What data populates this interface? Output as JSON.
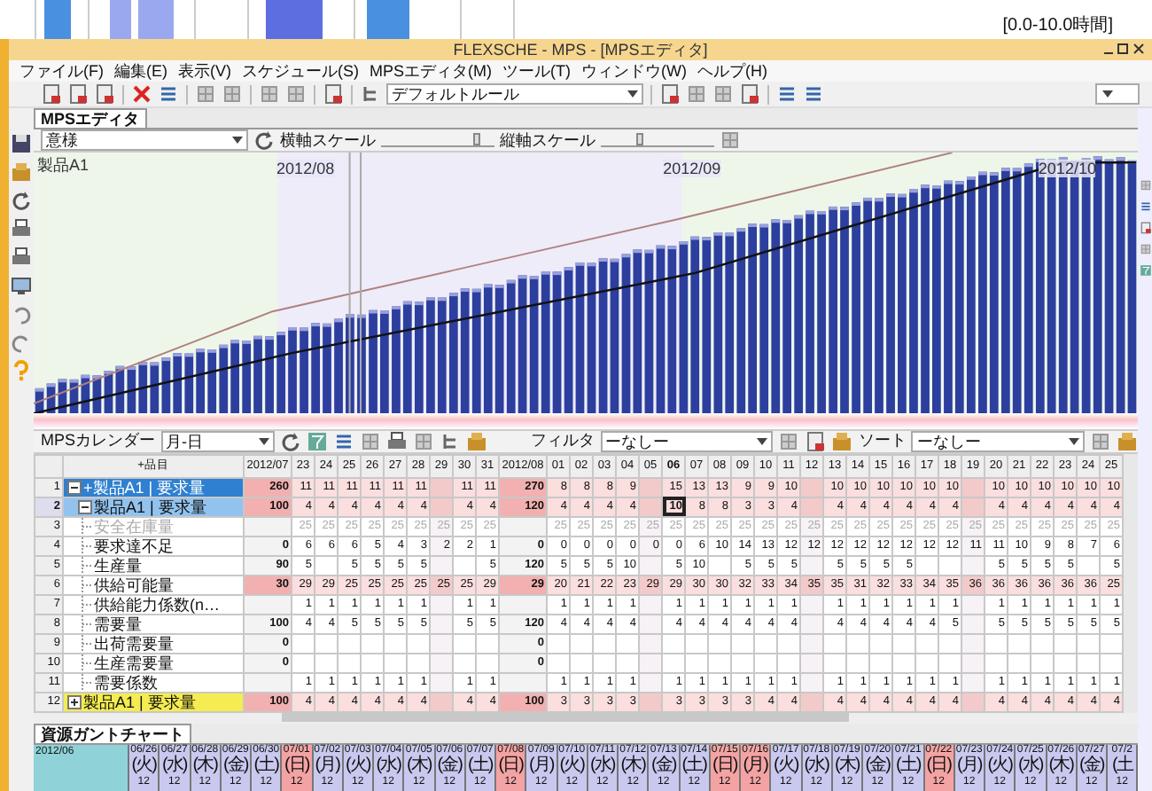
{
  "background_window": {
    "range": "[0.0-10.0時間]"
  },
  "window": {
    "title": "FLEXSCHE - MPS - [MPSエディタ]"
  },
  "menu": [
    "ファイル(F)",
    "編集(E)",
    "表示(V)",
    "スケジュール(S)",
    "MPSエディタ(M)",
    "ツール(T)",
    "ウィンドウ(W)",
    "ヘルプ(H)"
  ],
  "toolbar": {
    "rule": "デフォルトルール"
  },
  "tabs": [
    {
      "label": "MPSエディタ",
      "selected": true
    }
  ],
  "chart_toolbar": {
    "mode": "意様",
    "x_scale_label": "横軸スケール",
    "x_scale": {
      "level": 0.85
    },
    "y_scale_label": "縦軸スケール",
    "y_scale": {
      "level": 0.35
    }
  },
  "chart": {
    "title": "製品A1",
    "months": [
      "2012/08",
      "2012/09",
      "2012/10"
    ]
  },
  "grid_toolbar": {
    "calendar_label": "MPSカレンダー",
    "calendar": "月-日",
    "filter_label": "フィルタ",
    "filter": "ーなしー",
    "sort_label": "ソート",
    "sort": "ーなしー"
  },
  "grid": {
    "corner": "+品目",
    "columns": [
      {
        "label": "2012/07",
        "kind": "month",
        "selected": false
      },
      {
        "label": "23",
        "kind": "day",
        "selected": false
      },
      {
        "label": "24",
        "kind": "day",
        "selected": false
      },
      {
        "label": "25",
        "kind": "day",
        "selected": false
      },
      {
        "label": "26",
        "kind": "day",
        "selected": false
      },
      {
        "label": "27",
        "kind": "day",
        "selected": false
      },
      {
        "label": "28",
        "kind": "day",
        "selected": false
      },
      {
        "label": "29",
        "kind": "holiday",
        "selected": false
      },
      {
        "label": "30",
        "kind": "day",
        "selected": false
      },
      {
        "label": "31",
        "kind": "day",
        "selected": false
      },
      {
        "label": "2012/08",
        "kind": "month",
        "selected": false
      },
      {
        "label": "01",
        "kind": "day",
        "selected": false
      },
      {
        "label": "02",
        "kind": "day",
        "selected": false
      },
      {
        "label": "03",
        "kind": "day",
        "selected": false
      },
      {
        "label": "04",
        "kind": "day",
        "selected": false
      },
      {
        "label": "05",
        "kind": "holiday",
        "selected": false
      },
      {
        "label": "06",
        "kind": "day",
        "selected": true
      },
      {
        "label": "07",
        "kind": "day",
        "selected": false
      },
      {
        "label": "08",
        "kind": "day",
        "selected": false
      },
      {
        "label": "09",
        "kind": "day",
        "selected": false
      },
      {
        "label": "10",
        "kind": "day",
        "selected": false
      },
      {
        "label": "11",
        "kind": "day",
        "selected": false
      },
      {
        "label": "12",
        "kind": "holiday",
        "selected": false
      },
      {
        "label": "13",
        "kind": "day",
        "selected": false
      },
      {
        "label": "14",
        "kind": "day",
        "selected": false
      },
      {
        "label": "15",
        "kind": "day",
        "selected": false
      },
      {
        "label": "16",
        "kind": "day",
        "selected": false
      },
      {
        "label": "17",
        "kind": "day",
        "selected": false
      },
      {
        "label": "18",
        "kind": "day",
        "selected": false
      },
      {
        "label": "19",
        "kind": "holiday",
        "selected": false
      },
      {
        "label": "20",
        "kind": "day",
        "selected": false
      },
      {
        "label": "21",
        "kind": "day",
        "selected": false
      },
      {
        "label": "22",
        "kind": "day",
        "selected": false
      },
      {
        "label": "23",
        "kind": "day",
        "selected": false
      },
      {
        "label": "24",
        "kind": "day",
        "selected": false
      },
      {
        "label": "25",
        "kind": "day",
        "selected": false
      }
    ],
    "rows": [
      {
        "number": "1",
        "label": "+製品A1 | 要求量",
        "kind": "group",
        "expanded": true,
        "selected": false,
        "highlight": true,
        "disabled": false,
        "cells": [
          "260",
          "11",
          "11",
          "11",
          "11",
          "11",
          "11",
          null,
          "11",
          "11",
          "270",
          "8",
          "8",
          "8",
          "9",
          null,
          "15",
          "13",
          "13",
          "9",
          "9",
          "10",
          null,
          "10",
          "10",
          "10",
          "10",
          "10",
          "10",
          null,
          "10",
          "10",
          "10",
          "10",
          "10",
          "10"
        ]
      },
      {
        "number": "2",
        "label": "製品A1 | 要求量",
        "kind": "item",
        "expanded": true,
        "selected": true,
        "highlight": true,
        "disabled": false,
        "cells": [
          "100",
          "4",
          "4",
          "4",
          "4",
          "4",
          "4",
          null,
          "4",
          "4",
          "120",
          "4",
          "4",
          "4",
          "4",
          null,
          "10",
          "8",
          "8",
          "3",
          "3",
          "4",
          null,
          "4",
          "4",
          "4",
          "4",
          "4",
          "4",
          null,
          "4",
          "4",
          "4",
          "4",
          "4",
          "4"
        ]
      },
      {
        "number": "3",
        "label": "安全在庫量",
        "kind": "attribute",
        "selected": false,
        "highlight": false,
        "disabled": true,
        "cells": [
          null,
          "25",
          "25",
          "25",
          "25",
          "25",
          "25",
          "25",
          "25",
          "25",
          null,
          "25",
          "25",
          "25",
          "25",
          "25",
          "25",
          "25",
          "25",
          "25",
          "25",
          "25",
          "25",
          "25",
          "25",
          "25",
          "25",
          "25",
          "25",
          "25",
          "25",
          "25",
          "25",
          "25",
          "25",
          "25"
        ]
      },
      {
        "number": "4",
        "label": "要求達不足",
        "kind": "attribute",
        "selected": false,
        "highlight": false,
        "disabled": false,
        "cells": [
          "0",
          "6",
          "6",
          "6",
          "5",
          "4",
          "3",
          "2",
          "2",
          "1",
          "0",
          "0",
          "0",
          "0",
          "0",
          "0",
          "0",
          "6",
          "10",
          "14",
          "13",
          "12",
          "12",
          "12",
          "12",
          "12",
          "12",
          "12",
          "12",
          "11",
          "11",
          "10",
          "9",
          "8",
          "7",
          "6"
        ]
      },
      {
        "number": "5",
        "label": "生産量",
        "kind": "attribute",
        "selected": false,
        "highlight": false,
        "disabled": false,
        "cells": [
          "90",
          "5",
          null,
          "5",
          "5",
          "5",
          "5",
          null,
          null,
          "5",
          "120",
          "5",
          "5",
          "5",
          "10",
          null,
          "5",
          "10",
          null,
          "5",
          "5",
          "5",
          null,
          "5",
          "5",
          "5",
          "5",
          null,
          null,
          null,
          "5",
          "5",
          "5",
          "5",
          null,
          "5"
        ]
      },
      {
        "number": "6",
        "label": "供給可能量",
        "kind": "attribute",
        "selected": false,
        "highlight": true,
        "disabled": false,
        "cells": [
          "30",
          "29",
          "29",
          "25",
          "25",
          "25",
          "25",
          "25",
          "25",
          "29",
          "29",
          "20",
          "21",
          "22",
          "23",
          "29",
          "29",
          "30",
          "30",
          "32",
          "33",
          "34",
          "35",
          "35",
          "31",
          "32",
          "33",
          "34",
          "35",
          "36",
          "36",
          "36",
          "36",
          "36",
          "36",
          "25"
        ]
      },
      {
        "number": "7",
        "label": "供給能力係数(n…",
        "kind": "attribute",
        "selected": false,
        "highlight": false,
        "disabled": false,
        "cells": [
          null,
          "1",
          "1",
          "1",
          "1",
          "1",
          "1",
          null,
          "1",
          "1",
          null,
          "1",
          "1",
          "1",
          "1",
          null,
          "1",
          "1",
          "1",
          "1",
          "1",
          "1",
          null,
          "1",
          "1",
          "1",
          "1",
          "1",
          "1",
          null,
          "1",
          "1",
          "1",
          "1",
          "1",
          "1"
        ]
      },
      {
        "number": "8",
        "label": "需要量",
        "kind": "attribute",
        "selected": false,
        "highlight": false,
        "disabled": false,
        "cells": [
          "100",
          "4",
          "4",
          "5",
          "5",
          "5",
          "5",
          null,
          "5",
          "5",
          "120",
          "4",
          "4",
          "4",
          "4",
          null,
          "4",
          "4",
          "4",
          "4",
          "4",
          "4",
          null,
          "4",
          "4",
          "4",
          "4",
          "4",
          "5",
          null,
          "5",
          "5",
          "5",
          "5",
          "5",
          "5"
        ]
      },
      {
        "number": "9",
        "label": "出荷需要量",
        "kind": "attribute",
        "selected": false,
        "highlight": false,
        "disabled": false,
        "cells": [
          "0",
          null,
          null,
          null,
          null,
          null,
          null,
          null,
          null,
          null,
          "0",
          null,
          null,
          null,
          null,
          null,
          null,
          null,
          null,
          null,
          null,
          null,
          null,
          null,
          null,
          null,
          null,
          null,
          null,
          null,
          null,
          null,
          null,
          null,
          null,
          null
        ]
      },
      {
        "number": "10",
        "label": "生産需要量",
        "kind": "attribute",
        "selected": false,
        "highlight": false,
        "disabled": false,
        "cells": [
          "0",
          null,
          null,
          null,
          null,
          null,
          null,
          null,
          null,
          null,
          "0",
          null,
          null,
          null,
          null,
          null,
          null,
          null,
          null,
          null,
          null,
          null,
          null,
          null,
          null,
          null,
          null,
          null,
          null,
          null,
          null,
          null,
          null,
          null,
          null,
          null
        ]
      },
      {
        "number": "11",
        "label": "需要係数",
        "kind": "attribute",
        "selected": false,
        "highlight": false,
        "disabled": false,
        "cells": [
          null,
          "1",
          "1",
          "1",
          "1",
          "1",
          "1",
          null,
          "1",
          "1",
          null,
          "1",
          "1",
          "1",
          "1",
          null,
          "1",
          "1",
          "1",
          "1",
          "1",
          "1",
          null,
          "1",
          "1",
          "1",
          "1",
          "1",
          "1",
          null,
          "1",
          "1",
          "1",
          "1",
          "1",
          "1"
        ]
      },
      {
        "number": "12",
        "label": "製品A1 | 要求量",
        "kind": "total",
        "expanded": false,
        "selected": false,
        "highlight": true,
        "disabled": false,
        "cells": [
          "100",
          "4",
          "4",
          "4",
          "4",
          "4",
          "4",
          null,
          "4",
          "4",
          "100",
          "3",
          "3",
          "3",
          "3",
          null,
          "3",
          "3",
          "3",
          "3",
          "4",
          "4",
          null,
          "4",
          "4",
          "4",
          "4",
          "4",
          "4",
          null,
          "4",
          "4",
          "4",
          "4",
          "4",
          "4"
        ]
      }
    ]
  },
  "gantt": {
    "tab": "資源ガントチャート",
    "month": "2012/06",
    "days": [
      {
        "date": "06/26",
        "weekday": "(火)",
        "value": "12",
        "holiday": false
      },
      {
        "date": "06/27",
        "weekday": "(水)",
        "value": "12",
        "holiday": false
      },
      {
        "date": "06/28",
        "weekday": "(木)",
        "value": "12",
        "holiday": false
      },
      {
        "date": "06/29",
        "weekday": "(金)",
        "value": "12",
        "holiday": false
      },
      {
        "date": "06/30",
        "weekday": "(土)",
        "value": "12",
        "holiday": false
      },
      {
        "date": "07/01",
        "weekday": "(日)",
        "value": "12",
        "holiday": true
      },
      {
        "date": "07/02",
        "weekday": "(月)",
        "value": "12",
        "holiday": false
      },
      {
        "date": "07/03",
        "weekday": "(火)",
        "value": "12",
        "holiday": false
      },
      {
        "date": "07/04",
        "weekday": "(水)",
        "value": "12",
        "holiday": false
      },
      {
        "date": "07/05",
        "weekday": "(木)",
        "value": "12",
        "holiday": false
      },
      {
        "date": "07/06",
        "weekday": "(金)",
        "value": "12",
        "holiday": false
      },
      {
        "date": "07/07",
        "weekday": "(土)",
        "value": "12",
        "holiday": false
      },
      {
        "date": "07/08",
        "weekday": "(日)",
        "value": "12",
        "holiday": true
      },
      {
        "date": "07/09",
        "weekday": "(月)",
        "value": "12",
        "holiday": false
      },
      {
        "date": "07/10",
        "weekday": "(火)",
        "value": "12",
        "holiday": false
      },
      {
        "date": "07/11",
        "weekday": "(水)",
        "value": "12",
        "holiday": false
      },
      {
        "date": "07/12",
        "weekday": "(木)",
        "value": "12",
        "holiday": false
      },
      {
        "date": "07/13",
        "weekday": "(金)",
        "value": "12",
        "holiday": false
      },
      {
        "date": "07/14",
        "weekday": "(土)",
        "value": "12",
        "holiday": false
      },
      {
        "date": "07/15",
        "weekday": "(日)",
        "value": "12",
        "holiday": true
      },
      {
        "date": "07/16",
        "weekday": "(月)",
        "value": "12",
        "holiday": true
      },
      {
        "date": "07/17",
        "weekday": "(火)",
        "value": "12",
        "holiday": false
      },
      {
        "date": "07/18",
        "weekday": "(水)",
        "value": "12",
        "holiday": false
      },
      {
        "date": "07/19",
        "weekday": "(木)",
        "value": "12",
        "holiday": false
      },
      {
        "date": "07/20",
        "weekday": "(金)",
        "value": "12",
        "holiday": false
      },
      {
        "date": "07/21",
        "weekday": "(土)",
        "value": "12",
        "holiday": false
      },
      {
        "date": "07/22",
        "weekday": "(日)",
        "value": "12",
        "holiday": true
      },
      {
        "date": "07/23",
        "weekday": "(月)",
        "value": "12",
        "holiday": false
      },
      {
        "date": "07/24",
        "weekday": "(火)",
        "value": "12",
        "holiday": false
      },
      {
        "date": "07/25",
        "weekday": "(水)",
        "value": "12",
        "holiday": false
      },
      {
        "date": "07/26",
        "weekday": "(木)",
        "value": "12",
        "holiday": false
      },
      {
        "date": "07/27",
        "weekday": "(金)",
        "value": "12",
        "holiday": false
      },
      {
        "date": "07/2",
        "weekday": "(土",
        "value": "12",
        "holiday": false
      }
    ]
  }
}
